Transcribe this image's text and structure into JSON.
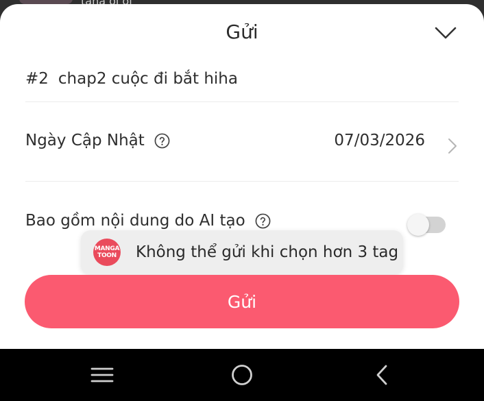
{
  "background": {
    "partial_text": "tana oi oi"
  },
  "sheet": {
    "title": "Gửi",
    "chapter_number": "#2",
    "chapter_title": "chap2 cuộc đi bắt hiha",
    "update_date_label": "Ngày Cập Nhật",
    "update_date_value": "07/03/2026",
    "ai_content_label": "Bao gồm nội dung do AI tạo",
    "ai_content_enabled": false,
    "submit_label": "Gửi"
  },
  "toast": {
    "logo_line1": "MANGA",
    "logo_line2": "TOON",
    "message": "Không thể gửi khi chọn hơn 3 tag"
  },
  "colors": {
    "accent": "#fb5a70",
    "logo": "#ea4b5c"
  },
  "icons": [
    "chevron-down-icon",
    "help-icon",
    "chevron-right-icon",
    "menu-icon",
    "home-icon",
    "back-icon"
  ]
}
